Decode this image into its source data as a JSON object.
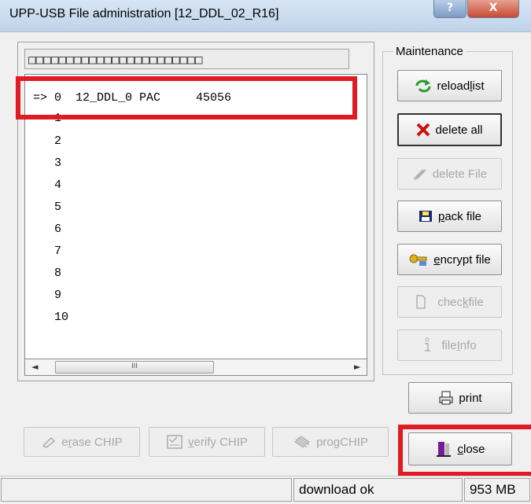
{
  "window": {
    "title": "UPP-USB File administration [12_DDL_02_R16]",
    "help_label": "?",
    "close_label": "X"
  },
  "list": {
    "header_text": "□□□□□□□□□□□□□□□□□□□□□□□",
    "rows": [
      "=> 0  12_DDL_0 PAC     45056",
      "   1",
      "   2",
      "   3",
      "   4",
      "   5",
      "   6",
      "   7",
      "   8",
      "   9",
      "   10"
    ],
    "scroll_left": "◄",
    "scroll_right": "►",
    "scroll_grip": "III"
  },
  "maintenance": {
    "label": "Maintenance",
    "reload_list": {
      "pre": "reload ",
      "ul": "l",
      "post": "ist"
    },
    "delete_all": {
      "pre": "delete all",
      "ul": "",
      "post": ""
    },
    "delete_file": {
      "pre": "delete File",
      "ul": "",
      "post": ""
    },
    "pack_file": {
      "pre": "",
      "ul": "p",
      "post": "ack file"
    },
    "encrypt_file": {
      "pre": "",
      "ul": "e",
      "post": "ncrypt file"
    },
    "check_file": {
      "pre": "chec",
      "ul": "k",
      "post": " file"
    },
    "file_info": {
      "pre": "file ",
      "ul": "I",
      "post": "nfo"
    }
  },
  "print_button": {
    "pre": "",
    "ul": "",
    "post": "print"
  },
  "chip": {
    "erase": {
      "pre": "e",
      "ul": "r",
      "post": "ase CHIP"
    },
    "verify": {
      "pre": "",
      "ul": "v",
      "post": "erify CHIP"
    },
    "prog": {
      "pre": "pro",
      "ul": "g",
      "post": " CHIP"
    }
  },
  "close_button": {
    "pre": "",
    "ul": "c",
    "post": "lose"
  },
  "status": {
    "left": "",
    "message": "download ok",
    "size": "953 MB"
  },
  "colors": {
    "highlight": "#e01b24",
    "delete_x": "#d01010",
    "reload_arrow": "#2a9a2a"
  }
}
